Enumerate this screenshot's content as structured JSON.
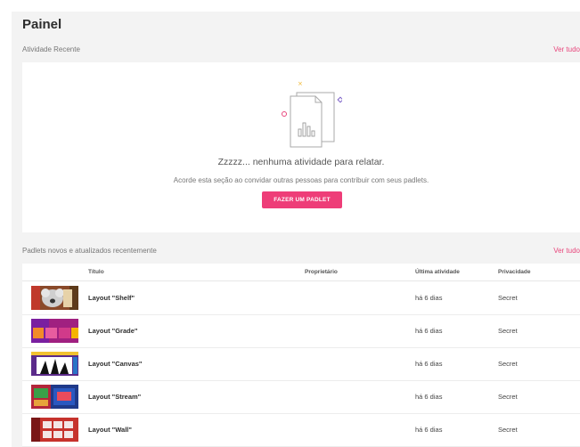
{
  "page_title": "Painel",
  "recent": {
    "section_title": "Atividade Recente",
    "see_all": "Ver tudo",
    "empty_heading": "Zzzzz... nenhuma atividade para relatar.",
    "empty_sub": "Acorde esta seção ao convidar outras pessoas para contribuir com seus padlets.",
    "cta_label": "FAZER UM PADLET"
  },
  "padlets": {
    "section_title": "Padlets novos e atualizados recentemente",
    "see_all": "Ver tudo",
    "columns": {
      "title": "Título",
      "owner": "Proprietário",
      "last_activity": "Última atividade",
      "privacy": "Privacidade"
    },
    "rows": [
      {
        "title": "Layout \"Shelf\"",
        "last_activity": "há 6 dias",
        "privacy": "Secret",
        "thumb": "shelf"
      },
      {
        "title": "Layout \"Grade\"",
        "last_activity": "há 6 dias",
        "privacy": "Secret",
        "thumb": "grade"
      },
      {
        "title": "Layout \"Canvas\"",
        "last_activity": "há 6 dias",
        "privacy": "Secret",
        "thumb": "canvas"
      },
      {
        "title": "Layout \"Stream\"",
        "last_activity": "há 6 dias",
        "privacy": "Secret",
        "thumb": "stream"
      },
      {
        "title": "Layout \"Wall\"",
        "last_activity": "há 6 dias",
        "privacy": "Secret",
        "thumb": "wall"
      }
    ]
  },
  "colors": {
    "accent": "#ee3d78",
    "link": "#e8467c",
    "background": "#f3f3f3"
  }
}
